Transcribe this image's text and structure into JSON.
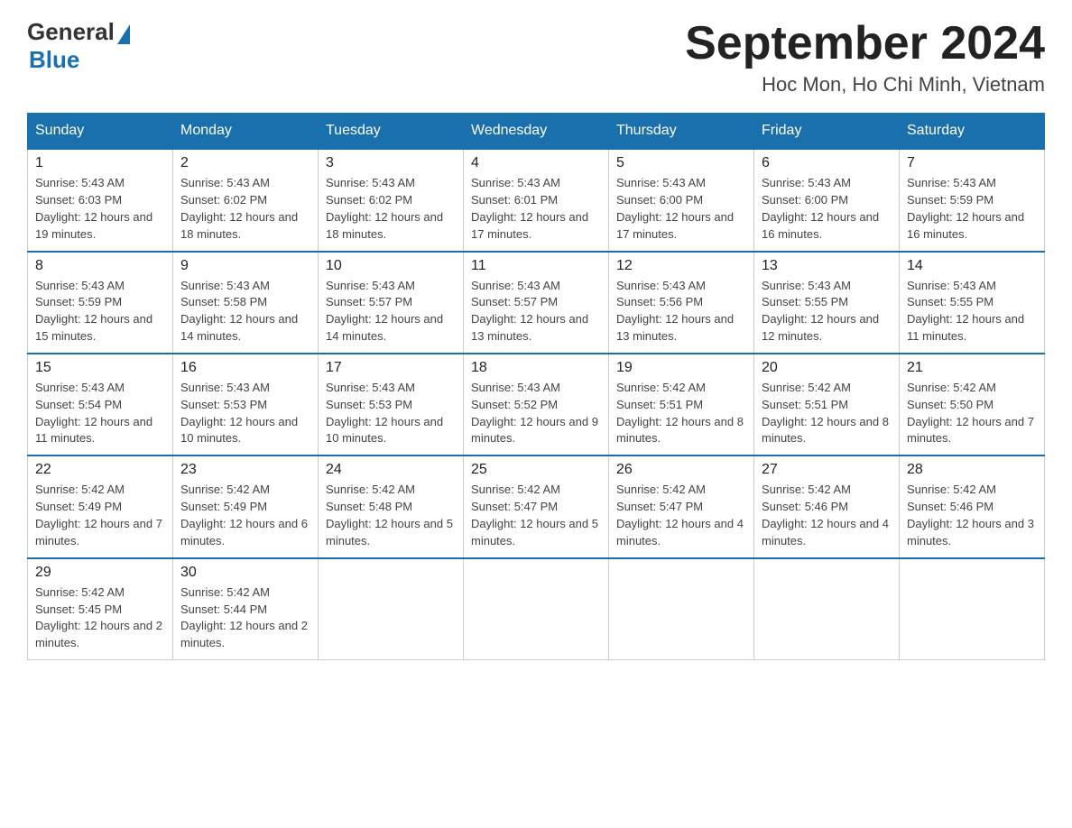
{
  "header": {
    "logo_general": "General",
    "logo_blue": "Blue",
    "title": "September 2024",
    "subtitle": "Hoc Mon, Ho Chi Minh, Vietnam"
  },
  "weekdays": [
    "Sunday",
    "Monday",
    "Tuesday",
    "Wednesday",
    "Thursday",
    "Friday",
    "Saturday"
  ],
  "weeks": [
    [
      {
        "day": "1",
        "sunrise": "5:43 AM",
        "sunset": "6:03 PM",
        "daylight": "12 hours and 19 minutes."
      },
      {
        "day": "2",
        "sunrise": "5:43 AM",
        "sunset": "6:02 PM",
        "daylight": "12 hours and 18 minutes."
      },
      {
        "day": "3",
        "sunrise": "5:43 AM",
        "sunset": "6:02 PM",
        "daylight": "12 hours and 18 minutes."
      },
      {
        "day": "4",
        "sunrise": "5:43 AM",
        "sunset": "6:01 PM",
        "daylight": "12 hours and 17 minutes."
      },
      {
        "day": "5",
        "sunrise": "5:43 AM",
        "sunset": "6:00 PM",
        "daylight": "12 hours and 17 minutes."
      },
      {
        "day": "6",
        "sunrise": "5:43 AM",
        "sunset": "6:00 PM",
        "daylight": "12 hours and 16 minutes."
      },
      {
        "day": "7",
        "sunrise": "5:43 AM",
        "sunset": "5:59 PM",
        "daylight": "12 hours and 16 minutes."
      }
    ],
    [
      {
        "day": "8",
        "sunrise": "5:43 AM",
        "sunset": "5:59 PM",
        "daylight": "12 hours and 15 minutes."
      },
      {
        "day": "9",
        "sunrise": "5:43 AM",
        "sunset": "5:58 PM",
        "daylight": "12 hours and 14 minutes."
      },
      {
        "day": "10",
        "sunrise": "5:43 AM",
        "sunset": "5:57 PM",
        "daylight": "12 hours and 14 minutes."
      },
      {
        "day": "11",
        "sunrise": "5:43 AM",
        "sunset": "5:57 PM",
        "daylight": "12 hours and 13 minutes."
      },
      {
        "day": "12",
        "sunrise": "5:43 AM",
        "sunset": "5:56 PM",
        "daylight": "12 hours and 13 minutes."
      },
      {
        "day": "13",
        "sunrise": "5:43 AM",
        "sunset": "5:55 PM",
        "daylight": "12 hours and 12 minutes."
      },
      {
        "day": "14",
        "sunrise": "5:43 AM",
        "sunset": "5:55 PM",
        "daylight": "12 hours and 11 minutes."
      }
    ],
    [
      {
        "day": "15",
        "sunrise": "5:43 AM",
        "sunset": "5:54 PM",
        "daylight": "12 hours and 11 minutes."
      },
      {
        "day": "16",
        "sunrise": "5:43 AM",
        "sunset": "5:53 PM",
        "daylight": "12 hours and 10 minutes."
      },
      {
        "day": "17",
        "sunrise": "5:43 AM",
        "sunset": "5:53 PM",
        "daylight": "12 hours and 10 minutes."
      },
      {
        "day": "18",
        "sunrise": "5:43 AM",
        "sunset": "5:52 PM",
        "daylight": "12 hours and 9 minutes."
      },
      {
        "day": "19",
        "sunrise": "5:42 AM",
        "sunset": "5:51 PM",
        "daylight": "12 hours and 8 minutes."
      },
      {
        "day": "20",
        "sunrise": "5:42 AM",
        "sunset": "5:51 PM",
        "daylight": "12 hours and 8 minutes."
      },
      {
        "day": "21",
        "sunrise": "5:42 AM",
        "sunset": "5:50 PM",
        "daylight": "12 hours and 7 minutes."
      }
    ],
    [
      {
        "day": "22",
        "sunrise": "5:42 AM",
        "sunset": "5:49 PM",
        "daylight": "12 hours and 7 minutes."
      },
      {
        "day": "23",
        "sunrise": "5:42 AM",
        "sunset": "5:49 PM",
        "daylight": "12 hours and 6 minutes."
      },
      {
        "day": "24",
        "sunrise": "5:42 AM",
        "sunset": "5:48 PM",
        "daylight": "12 hours and 5 minutes."
      },
      {
        "day": "25",
        "sunrise": "5:42 AM",
        "sunset": "5:47 PM",
        "daylight": "12 hours and 5 minutes."
      },
      {
        "day": "26",
        "sunrise": "5:42 AM",
        "sunset": "5:47 PM",
        "daylight": "12 hours and 4 minutes."
      },
      {
        "day": "27",
        "sunrise": "5:42 AM",
        "sunset": "5:46 PM",
        "daylight": "12 hours and 4 minutes."
      },
      {
        "day": "28",
        "sunrise": "5:42 AM",
        "sunset": "5:46 PM",
        "daylight": "12 hours and 3 minutes."
      }
    ],
    [
      {
        "day": "29",
        "sunrise": "5:42 AM",
        "sunset": "5:45 PM",
        "daylight": "12 hours and 2 minutes."
      },
      {
        "day": "30",
        "sunrise": "5:42 AM",
        "sunset": "5:44 PM",
        "daylight": "12 hours and 2 minutes."
      },
      null,
      null,
      null,
      null,
      null
    ]
  ]
}
